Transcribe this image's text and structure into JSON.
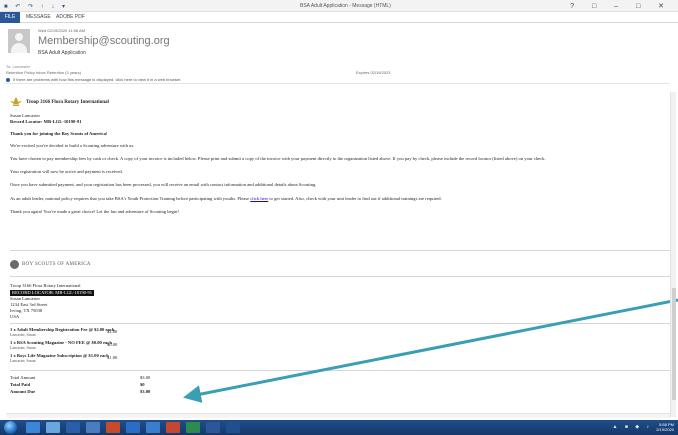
{
  "window": {
    "title": "BSA Adult Application - Message (HTML)",
    "quick_access": "■ ↶ ↷ ↑ ↓ ▾",
    "controls": "? □ – □ ✕"
  },
  "ribbon": {
    "file": "FILE",
    "message": "MESSAGE",
    "adobe_pdf": "ADOBE PDF"
  },
  "header": {
    "date": "Wed 02/19/2020 11:58 AM",
    "from": "Membership@scouting.org",
    "subject": "BSA Adult Application",
    "to": "To: Lancaster",
    "retention": "Retention Policy   Inbox Retention (3 years)",
    "expires": "Expires   02/19/2023",
    "infobar": "If there are problems with how this message is displayed, click here to view it in a web browser."
  },
  "body": {
    "troop": "Troop 3166 Flora Rotary International",
    "name": "Susan Lancaster",
    "record_locator": "Record Locator: MB-LGL-10190-91",
    "thanks": "Thank you for joining the Boy Scouts of America!",
    "p1": "We're excited you've decided to build a Scouting adventure with us.",
    "p2": "You have chosen to pay membership fees by cash or check. A copy of your invoice is included below. Please print and submit a copy of the invoice with your payment directly to the organization listed above. If you pay by check, please include the record locator (listed above) on your check.",
    "p3": "Your registration will now be active and payment is received.",
    "p4": "Once you have submitted payment, and your registration has been processed, you will receive an email with contact information and additional details about Scouting.",
    "p5_pre": "As an adult leader, national policy requires that you take BSA's Youth Protection Training before participating with youths. Please",
    "p5_link": "click here",
    "p5_post": "to get started. Also, check with your unit leader to find out if additional trainings are required.",
    "p6": "Thank you again! You've made a great choice! Let the fun and adventure of Scouting begin!"
  },
  "invoice": {
    "org_name": "BOY SCOUTS OF AMERICA",
    "troop": "Troop 3166 Flora Rotary International",
    "record_locator": "RECORD LOCATOR: MB-LGL-10190-91",
    "name": "Susan Lancaster",
    "address": "1234 East 3rd Street",
    "city": "Irving, TX 75038",
    "country": "USA",
    "items": [
      {
        "name": "1 x Adult Membership Registration Fee @ $2.00 each",
        "sub": "Lancaster, Susan",
        "price": "$2.00"
      },
      {
        "name": "1 x BSA Scouting Magazine - NO FEE @ $0.00 each",
        "sub": "Lancaster, Susan",
        "price": "$0.00"
      },
      {
        "name": "1 x Boys Life Magazine Subscription @ $1.00 each",
        "sub": "Lancaster, Susan",
        "price": "$1.00"
      }
    ],
    "total_amount_label": "Total Amount",
    "total_amount": "$3.00",
    "total_paid_label": "Total Paid",
    "total_paid": "$0",
    "amount_due_label": "Amount Due",
    "amount_due": "$3.00"
  },
  "taskbar": {
    "tray": "▲ ■ ◆ ♪",
    "time": "5:58 PM",
    "date": "2/19/2020"
  },
  "colors": {
    "accent": "#2b579a",
    "arrow": "#3a9eb5",
    "taskbar": "#1e4e8a"
  }
}
